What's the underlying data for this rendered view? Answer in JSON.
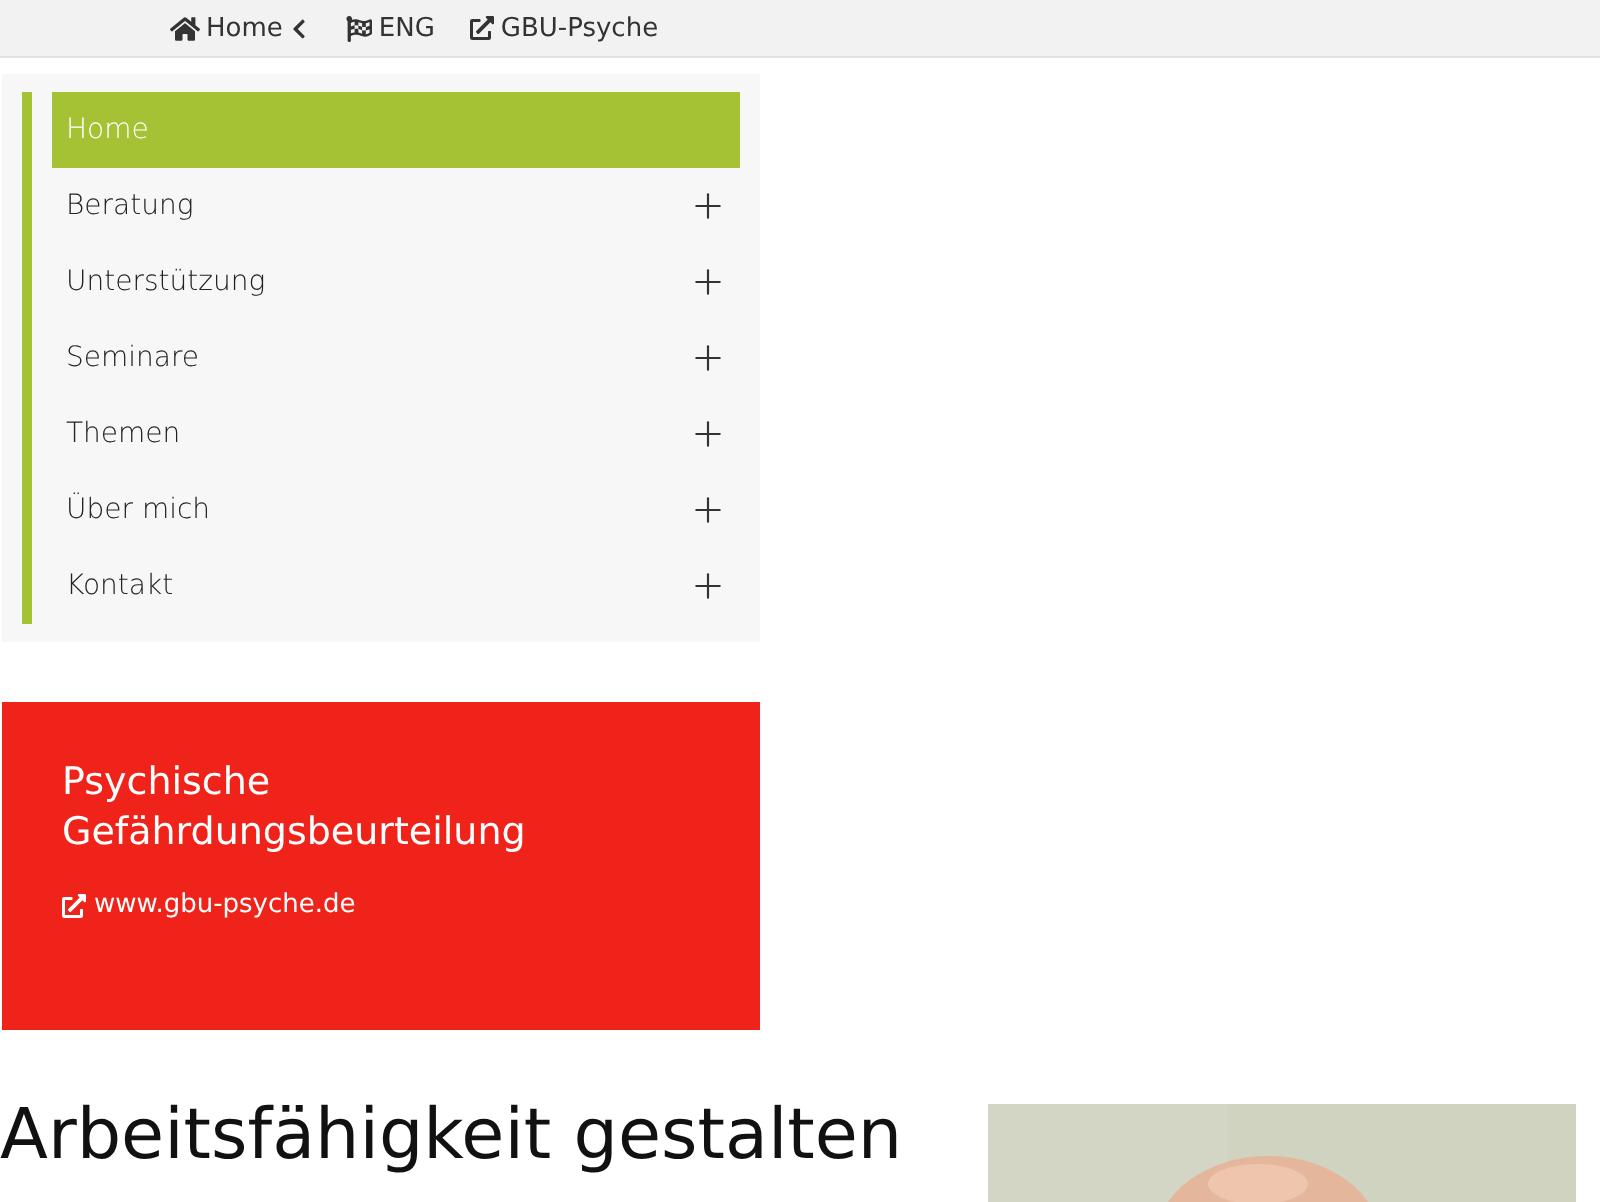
{
  "topbar": {
    "links": [
      {
        "kind": "home",
        "label": "Home"
      },
      {
        "kind": "language",
        "label": "ENG"
      },
      {
        "kind": "external",
        "label": "GBU-Psyche"
      }
    ]
  },
  "menu": {
    "items": [
      {
        "label": "Home",
        "selected": true,
        "kind": "link"
      },
      {
        "label": "Beratung",
        "selected": false,
        "kind": "submenu"
      },
      {
        "label": "Unterstützung",
        "selected": false,
        "kind": "submenu"
      },
      {
        "label": "Seminare",
        "selected": false,
        "kind": "submenu"
      },
      {
        "label": "Themen",
        "selected": false,
        "kind": "submenu"
      },
      {
        "label": "Über mich",
        "selected": false,
        "kind": "submenu"
      },
      {
        "label": "Kontakt",
        "selected": false,
        "kind": "submenu"
      }
    ]
  },
  "promo": {
    "title": "Psychische Gefährdungsbeurteilung",
    "link": "www.gbu-psyche.de"
  },
  "content": {
    "heading": "Arbeitsfähigkeit gestalten"
  }
}
